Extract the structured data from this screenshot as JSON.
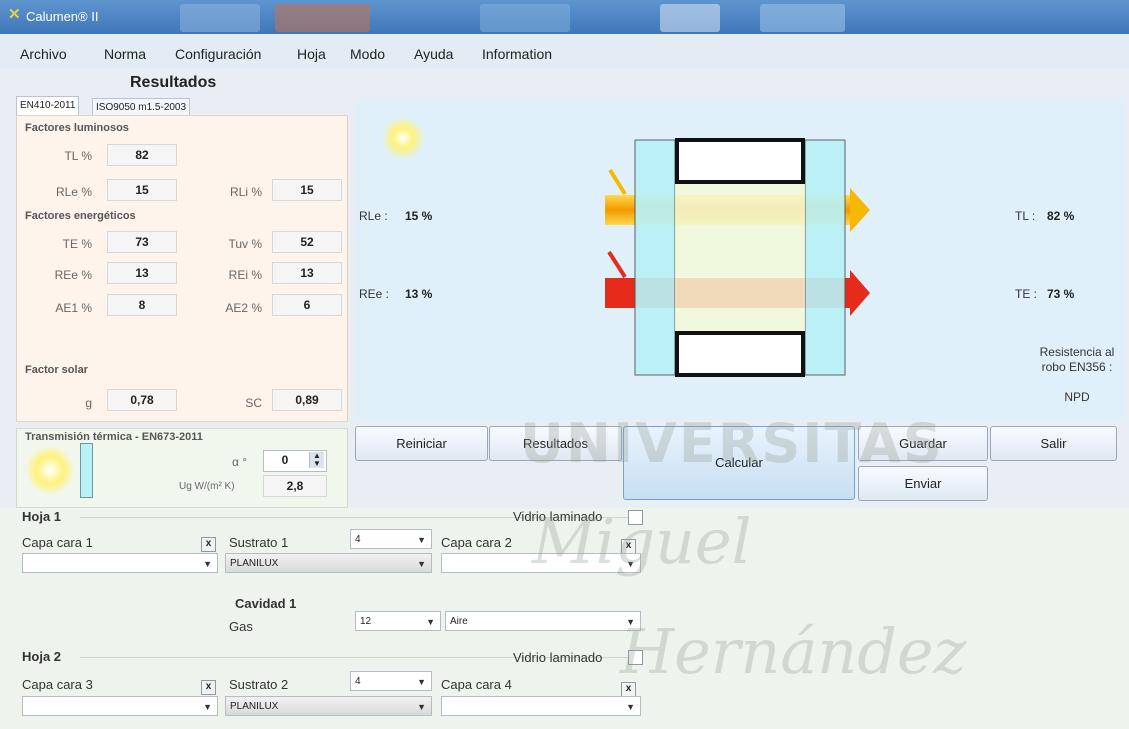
{
  "window": {
    "title": "Calumen® II"
  },
  "menu": [
    "Archivo",
    "Norma",
    "Configuración",
    "Hoja",
    "Modo",
    "Ayuda",
    "Information"
  ],
  "results_title": "Resultados",
  "tabs": [
    "EN410-2011",
    "ISO9050 m1.5-2003"
  ],
  "luminous": {
    "header": "Factores luminosos",
    "tl_label": "TL %",
    "tl_value": "82",
    "rle_label": "RLe %",
    "rle_value": "15",
    "rli_label": "RLi %",
    "rli_value": "15"
  },
  "energetic": {
    "header": "Factores energéticos",
    "te_label": "TE %",
    "te_value": "73",
    "tuv_label": "Tuv %",
    "tuv_value": "52",
    "ree_label": "REe %",
    "ree_value": "13",
    "rei_label": "REi %",
    "rei_value": "13",
    "ae1_label": "AE1 %",
    "ae1_value": "8",
    "ae2_label": "AE2 %",
    "ae2_value": "6"
  },
  "solar": {
    "header": "Factor solar",
    "g_label": "g",
    "g_value": "0,78",
    "sc_label": "SC",
    "sc_value": "0,89"
  },
  "diagram": {
    "rle_label": "RLe :",
    "rle_value": "15 %",
    "ree_label": "REe :",
    "ree_value": "13 %",
    "tl_label": "TL :",
    "tl_value": "82 %",
    "te_label": "TE :",
    "te_value": "73 %",
    "resistance_line1": "Resistencia al",
    "resistance_line2": "robo EN356 :",
    "resistance_value": "NPD"
  },
  "thermal": {
    "header": "Transmisión térmica - EN673-2011",
    "alpha_label": "α °",
    "alpha_value": "0",
    "ug_label": "Ug W/(m² K)",
    "ug_value": "2,8"
  },
  "buttons": {
    "reiniciar": "Reiniciar",
    "resultados": "Resultados",
    "calcular": "Calcular",
    "guardar": "Guardar",
    "salir": "Salir",
    "enviar": "Enviar"
  },
  "hoja1": {
    "title": "Hoja 1",
    "vidrio": "Vidrio laminado",
    "capa_cara_1": "Capa cara 1",
    "sustrato_label": "Sustrato 1",
    "sustrato_thickness": "4",
    "sustrato_value": "PLANILUX",
    "capa_cara_2": "Capa cara 2"
  },
  "cavidad1": {
    "title": "Cavidad 1",
    "gas_label": "Gas",
    "width": "12",
    "gas_value": "Aire"
  },
  "hoja2": {
    "title": "Hoja 2",
    "vidrio": "Vidrio laminado",
    "capa_cara_3": "Capa cara 3",
    "sustrato_label": "Sustrato 2",
    "sustrato_thickness": "4",
    "sustrato_value": "PLANILUX",
    "capa_cara_4": "Capa cara 4"
  },
  "watermark": {
    "line1": "UNIVERSITAS",
    "line2": "Miguel",
    "line3": "Hernández"
  },
  "colors": {
    "accent": "#3f76b8",
    "panel_left": "#fff4ec",
    "panel_right": "#dff0fb",
    "glass": "#b9f1f6",
    "light_arrow": "#f6b800",
    "energy_arrow": "#e52b1a"
  }
}
